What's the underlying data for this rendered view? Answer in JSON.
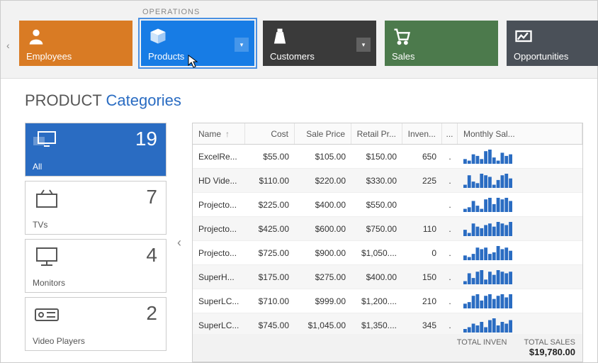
{
  "nav": {
    "section_label": "OPERATIONS",
    "tiles": [
      {
        "label": "Employees",
        "color": "orange"
      },
      {
        "label": "Products",
        "color": "blue",
        "has_dd": true,
        "selected": true
      },
      {
        "label": "Customers",
        "color": "dark",
        "has_dd": true
      },
      {
        "label": "Sales",
        "color": "green"
      },
      {
        "label": "Opportunities",
        "color": "slate"
      }
    ]
  },
  "page_title_prefix": "PRODUCT",
  "page_title_accent": "Categories",
  "categories": [
    {
      "name": "All",
      "count": 19,
      "selected": true
    },
    {
      "name": "TVs",
      "count": 7
    },
    {
      "name": "Monitors",
      "count": 4
    },
    {
      "name": "Video Players",
      "count": 2
    }
  ],
  "grid": {
    "columns": [
      "Name",
      "Cost",
      "Sale Price",
      "Retail Pr...",
      "Inven...",
      "...",
      "Monthly Sal..."
    ],
    "sort_col": 0,
    "rows": [
      {
        "name": "ExcelRe...",
        "cost": "$55.00",
        "sale": "$105.00",
        "retail": "$150.00",
        "inv": "650",
        "spark": [
          3,
          2,
          6,
          5,
          3,
          8,
          9,
          4,
          2,
          7,
          5,
          6
        ]
      },
      {
        "name": "HD Vide...",
        "cost": "$110.00",
        "sale": "$220.00",
        "retail": "$330.00",
        "inv": "225",
        "spark": [
          2,
          8,
          4,
          3,
          9,
          8,
          7,
          2,
          5,
          8,
          9,
          6
        ]
      },
      {
        "name": "Projecto...",
        "cost": "$225.00",
        "sale": "$400.00",
        "retail": "$550.00",
        "inv": "",
        "spark": [
          2,
          3,
          7,
          4,
          2,
          8,
          9,
          5,
          9,
          8,
          9,
          7
        ]
      },
      {
        "name": "Projecto...",
        "cost": "$425.00",
        "sale": "$600.00",
        "retail": "$750.00",
        "inv": "110",
        "spark": [
          4,
          2,
          8,
          6,
          5,
          7,
          8,
          6,
          9,
          8,
          7,
          9
        ]
      },
      {
        "name": "Projecto...",
        "cost": "$725.00",
        "sale": "$900.00",
        "retail": "$1,050....",
        "inv": "0",
        "spark": [
          3,
          2,
          4,
          8,
          7,
          8,
          4,
          5,
          9,
          7,
          8,
          6
        ]
      },
      {
        "name": "SuperH...",
        "cost": "$175.00",
        "sale": "$275.00",
        "retail": "$400.00",
        "inv": "150",
        "spark": [
          2,
          7,
          4,
          8,
          9,
          3,
          8,
          6,
          9,
          8,
          7,
          8
        ]
      },
      {
        "name": "SuperLC...",
        "cost": "$710.00",
        "sale": "$999.00",
        "retail": "$1,200....",
        "inv": "210",
        "spark": [
          3,
          4,
          8,
          9,
          5,
          8,
          9,
          6,
          8,
          9,
          7,
          9
        ]
      },
      {
        "name": "SuperLC...",
        "cost": "$745.00",
        "sale": "$1,045.00",
        "retail": "$1,350....",
        "inv": "345",
        "spark": [
          2,
          3,
          5,
          4,
          6,
          3,
          7,
          8,
          4,
          6,
          5,
          7
        ]
      }
    ],
    "footer": {
      "inven_label": "TOTAL INVEN",
      "sales_label": "TOTAL SALES",
      "sales_value": "$19,780.00"
    }
  }
}
